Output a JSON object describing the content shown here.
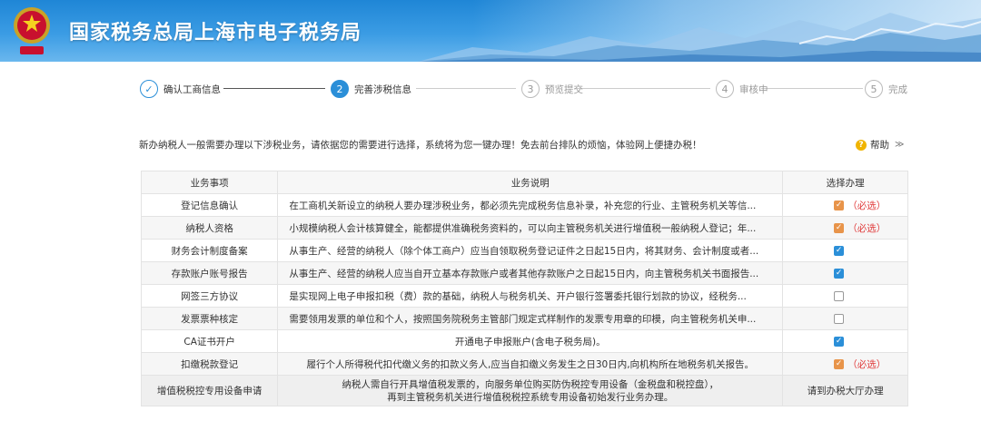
{
  "header": {
    "title": "国家税务总局上海市电子税务局"
  },
  "steps": [
    {
      "num": "✓",
      "label": "确认工商信息",
      "state": "done"
    },
    {
      "num": "2",
      "label": "完善涉税信息",
      "state": "active"
    },
    {
      "num": "3",
      "label": "预览提交",
      "state": "pending"
    },
    {
      "num": "4",
      "label": "审核中",
      "state": "pending"
    },
    {
      "num": "5",
      "label": "完成",
      "state": "pending"
    }
  ],
  "intro": "新办纳税人一般需要办理以下涉税业务，请依据您的需要进行选择，系统将为您一键办理！免去前台排队的烦恼，体验网上便捷办税！",
  "help": {
    "icon": "?",
    "label": "帮助",
    "chevron": "≫"
  },
  "table": {
    "headers": [
      "业务事项",
      "业务说明",
      "选择办理"
    ],
    "required_label": "（必选）",
    "rows": [
      {
        "item": "登记信息确认",
        "desc": "在工商机关新设立的纳税人要办理涉税业务，都必须先完成税务信息补录，补充您的行业、主管税务机关等信...",
        "status": "required"
      },
      {
        "item": "纳税人资格",
        "desc": "小规模纳税人会计核算健全，能都提供准确税务资料的，可以向主管税务机关进行增值税一般纳税人登记；年...",
        "status": "required"
      },
      {
        "item": "财务会计制度备案",
        "desc": "从事生产、经营的纳税人（除个体工商户）应当自领取税务登记证件之日起15日内，将其财务、会计制度或者...",
        "status": "checked"
      },
      {
        "item": "存款账户账号报告",
        "desc": "从事生产、经营的纳税人应当自开立基本存款账户或者其他存款账户之日起15日内，向主管税务机关书面报告...",
        "status": "checked"
      },
      {
        "item": "网签三方协议",
        "desc": "是实现网上电子申报扣税（费）款的基础，纳税人与税务机关、开户银行签署委托银行划款的协议，经税务...",
        "status": "unchecked"
      },
      {
        "item": "发票票种核定",
        "desc": "需要领用发票的单位和个人，按照国务院税务主管部门规定式样制作的发票专用章的印模，向主管税务机关申...",
        "status": "unchecked"
      },
      {
        "item": "CA证书开户",
        "desc": "开通电子申报账户(含电子税务局)。",
        "status": "checked",
        "center": true
      },
      {
        "item": "扣缴税款登记",
        "desc": "履行个人所得税代扣代缴义务的扣款义务人,应当自扣缴义务发生之日30日内,向机构所在地税务机关报告。",
        "status": "required",
        "center": true
      }
    ],
    "last_row": {
      "item": "增值税税控专用设备申请",
      "desc_line1": "纳税人需自行开具增值税发票的，向服务单位购买防伪税控专用设备（金税盘和税控盘），",
      "desc_line2": "再到主管税务机关进行增值税税控系统专用设备初始发行业务办理。",
      "action": "请到办税大厅办理"
    }
  },
  "colors": {
    "accent": "#2b8fd8",
    "required": "#e03a3a",
    "orange_check": "#e8944a"
  }
}
